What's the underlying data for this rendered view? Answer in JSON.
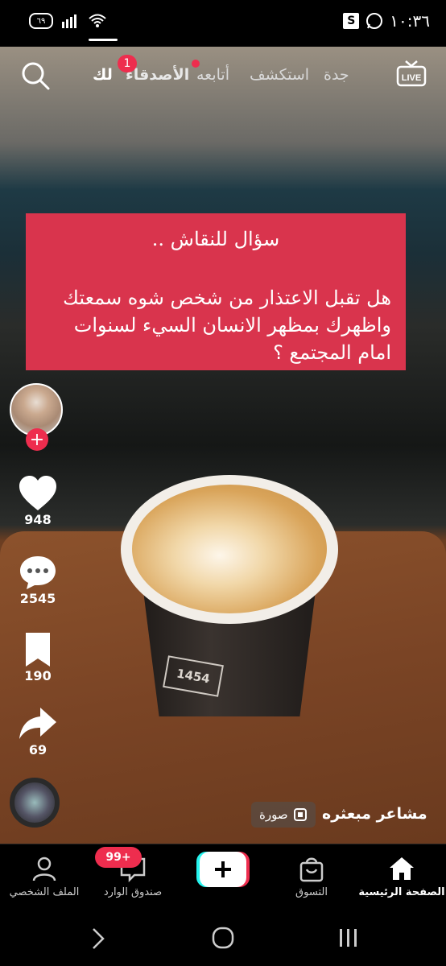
{
  "status_bar": {
    "time": "١٠:٣٦",
    "battery": "٦٩",
    "app_icon_letter": "S"
  },
  "top_nav": {
    "tabs": [
      {
        "label": "لك",
        "active": true
      },
      {
        "label": "الأصدقاء",
        "active": false
      },
      {
        "label": "أتابعه",
        "active": false
      },
      {
        "label": "استكشف",
        "active": false
      },
      {
        "label": "جدة",
        "active": false
      }
    ],
    "friends_badge": "1",
    "live_label": "LIVE"
  },
  "banner": {
    "title": "سؤال للنقاش ..",
    "body": "هل تقبل الاعتذار من شخص شوه سمعتك واظهرك بمظهر الانسان السيء لسنوات امام المجتمع ؟"
  },
  "cup_text": "1454",
  "actions": {
    "likes": "948",
    "comments": "2545",
    "saves": "190",
    "shares": "69"
  },
  "caption": {
    "sound_name": "مشاعر مبعثره",
    "photo_chip": "صورة"
  },
  "bottom_tabs": {
    "home": "الصفحة الرئيسية",
    "shop": "التسوق",
    "inbox": "صندوق الوارد",
    "profile": "الملف الشخصي",
    "inbox_badge": "99+"
  },
  "colors": {
    "accent": "#ee2d4e",
    "banner_bg": "#d9344d"
  }
}
